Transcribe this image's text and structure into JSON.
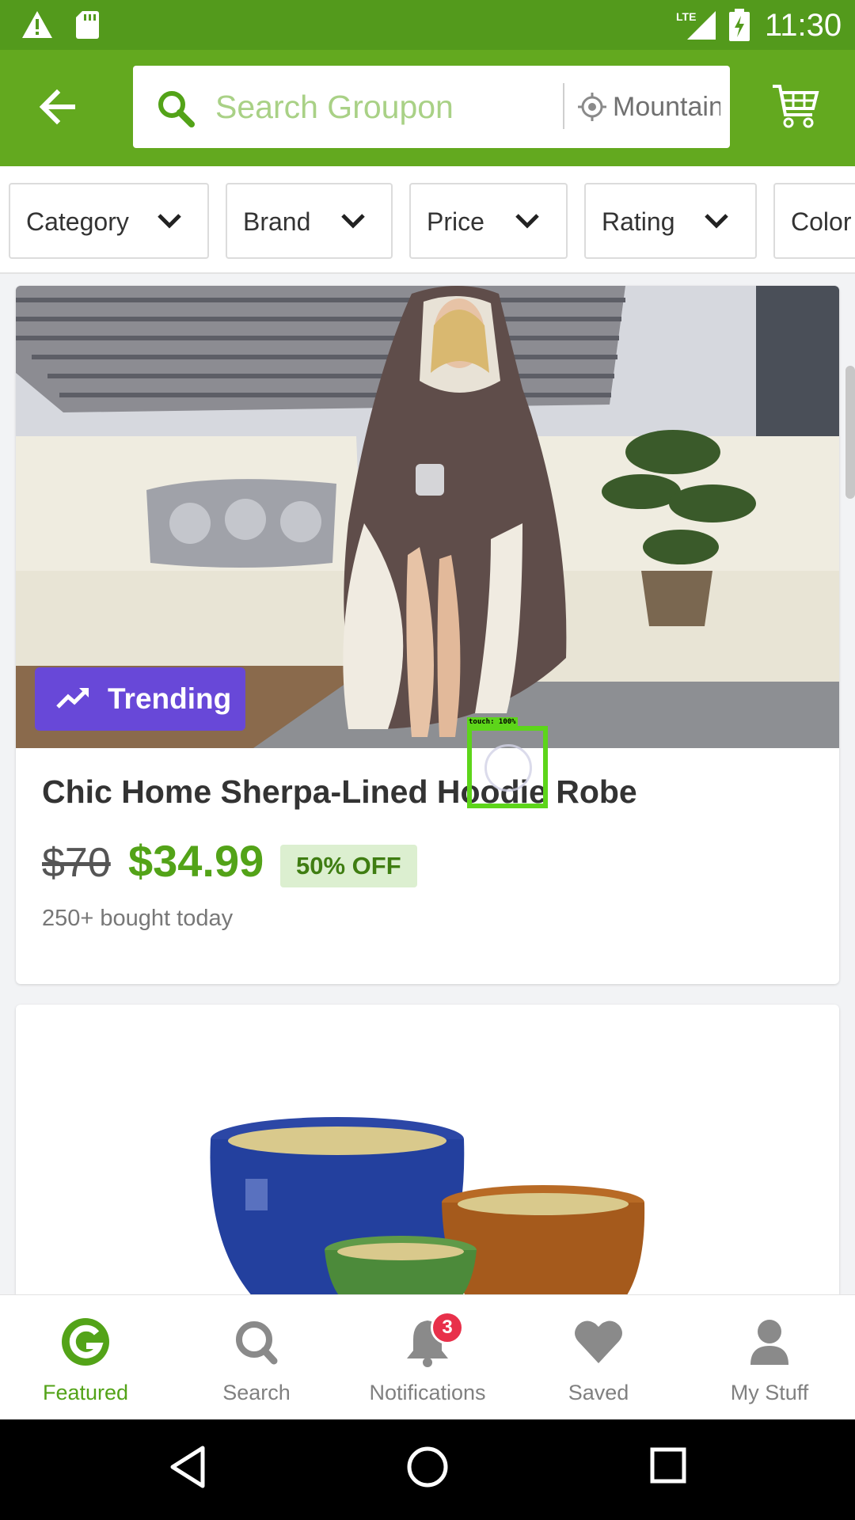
{
  "status_bar": {
    "time": "11:30",
    "network": "LTE",
    "icons": [
      "warning-icon",
      "sd-card-icon",
      "signal-icon",
      "battery-charging-icon"
    ]
  },
  "header": {
    "back_icon": "arrow-left-icon",
    "search_placeholder": "Search Groupon",
    "location": "Mountain View",
    "cart_icon": "cart-icon"
  },
  "filters": [
    {
      "label": "Category"
    },
    {
      "label": "Brand"
    },
    {
      "label": "Price"
    },
    {
      "label": "Rating"
    },
    {
      "label": "Color"
    }
  ],
  "deals": [
    {
      "badge": "Trending",
      "title": "Chic Home Sherpa-Lined Hoodie Robe",
      "original_price": "$70",
      "price": "$34.99",
      "discount": "50% OFF",
      "bought": "250+ bought today"
    }
  ],
  "touch_overlay": {
    "label": "touch: 100%"
  },
  "bottom_nav": {
    "items": [
      {
        "label": "Featured",
        "icon": "groupon-g-icon",
        "active": true
      },
      {
        "label": "Search",
        "icon": "search-icon"
      },
      {
        "label": "Notifications",
        "icon": "bell-icon",
        "badge": "3"
      },
      {
        "label": "Saved",
        "icon": "heart-icon"
      },
      {
        "label": "My Stuff",
        "icon": "person-icon"
      }
    ]
  },
  "colors": {
    "brand_green": "#63a91f",
    "status_green": "#539a1c",
    "price_green": "#53a318",
    "trending_purple": "#6848d8",
    "badge_red": "#e8304a"
  }
}
